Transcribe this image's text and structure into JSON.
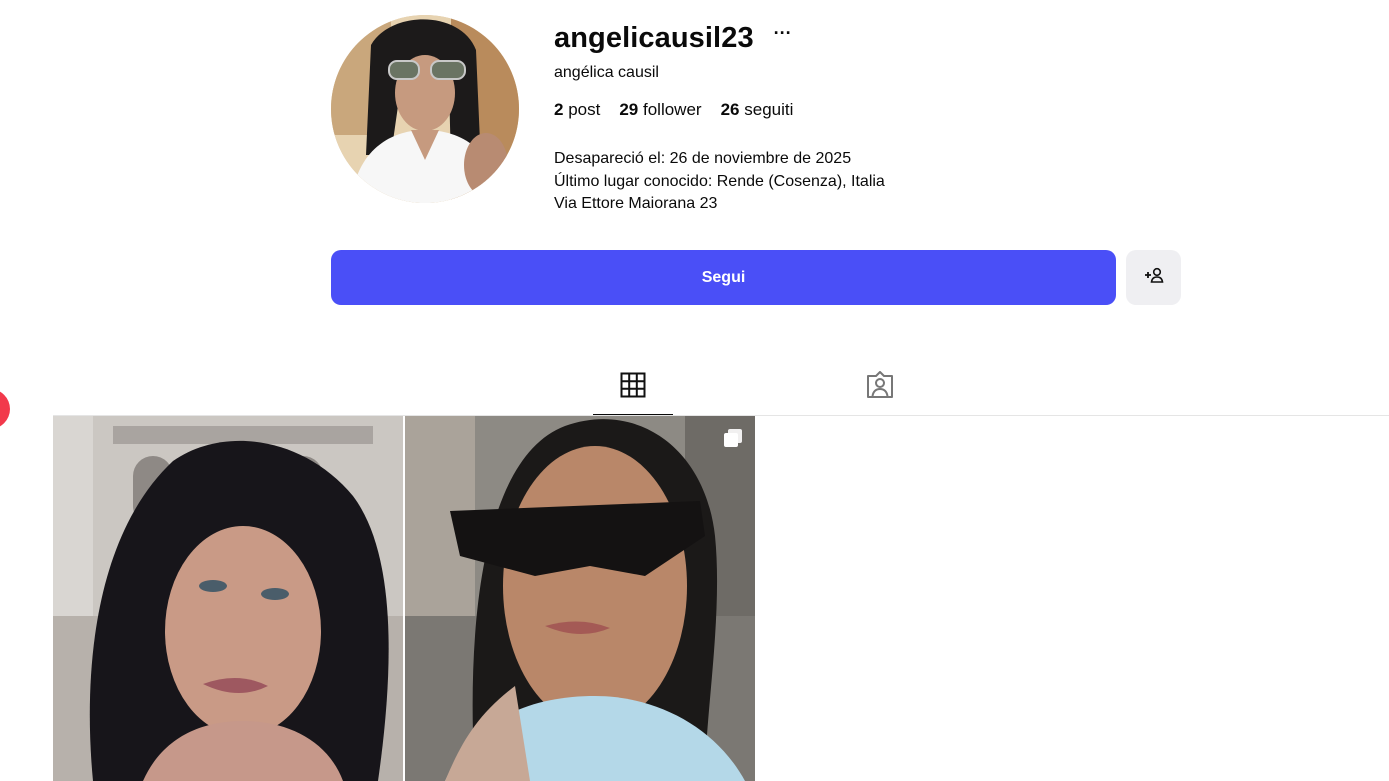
{
  "profile": {
    "username": "angelicausil23",
    "more_label": "···",
    "full_name": "angélica causil",
    "avatar_icon": "profile-photo",
    "stats": [
      {
        "value": "2",
        "label": "post"
      },
      {
        "value": "29",
        "label": "follower"
      },
      {
        "value": "26",
        "label": "seguiti"
      }
    ],
    "bio": [
      "Desapareció el: 26 de noviembre de 2025",
      "Último lugar conocido: Rende (Cosenza), Italia",
      "Via Ettore Maiorana 23"
    ]
  },
  "actions": {
    "follow_label": "Segui",
    "add_person_icon": "add-person-icon"
  },
  "tabs": [
    {
      "icon": "grid-icon",
      "active": true
    },
    {
      "icon": "tagged-icon",
      "active": false
    }
  ],
  "posts": [
    {
      "type": "photo",
      "icon": ""
    },
    {
      "type": "carousel",
      "icon": "carousel-icon"
    }
  ],
  "colors": {
    "accent": "#4a4ff7",
    "secondary_button": "#efeff2",
    "side_badge": "#f2394b"
  }
}
